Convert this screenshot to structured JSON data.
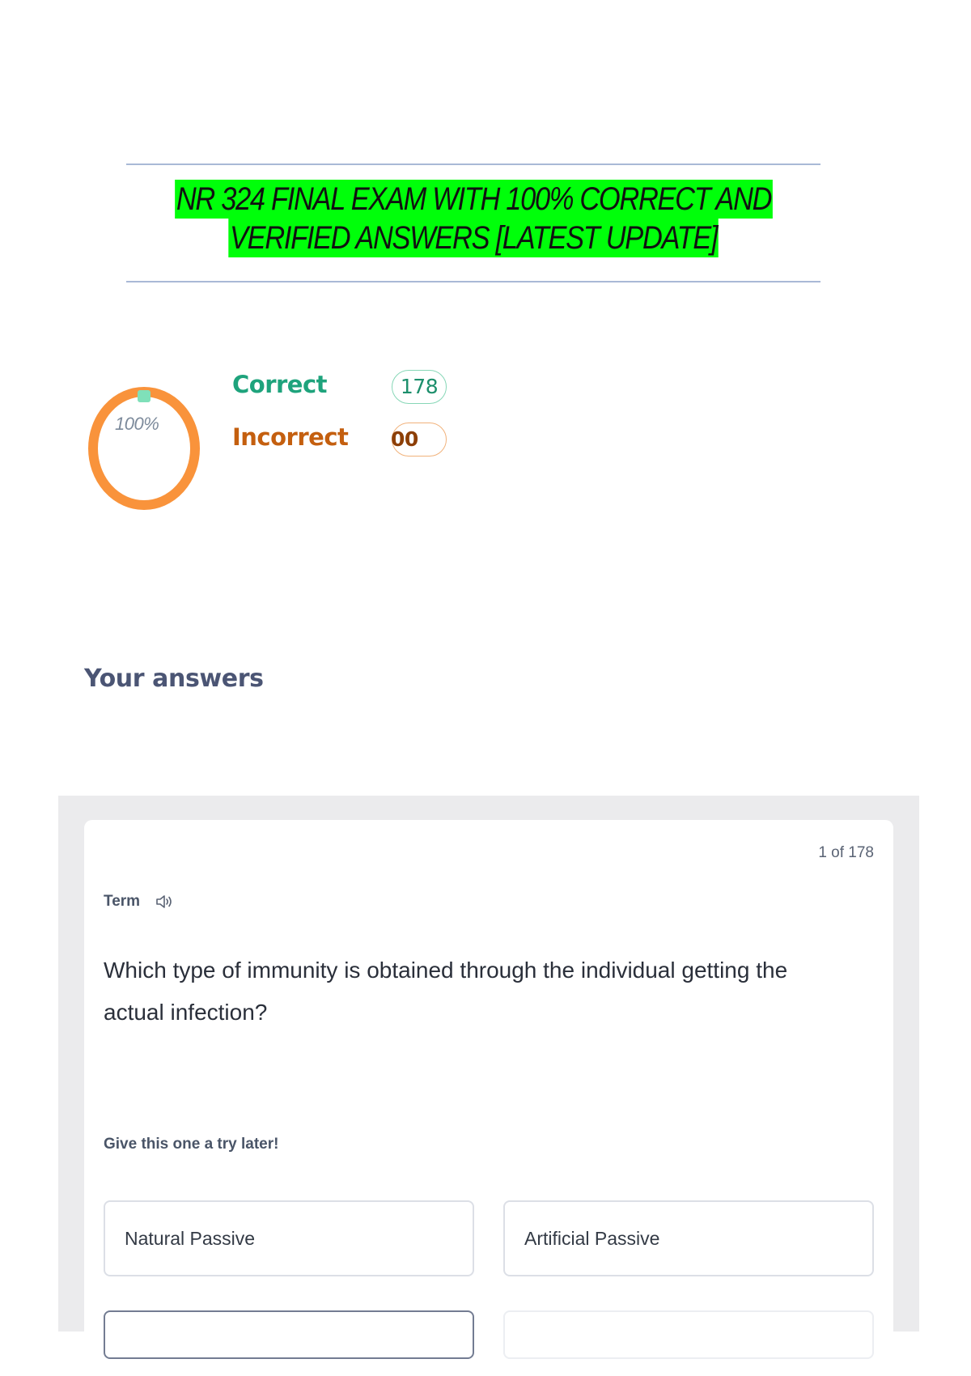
{
  "document": {
    "title_line_1": "NR 324 FINAL EXAM WITH 100% CORRECT AND",
    "title_line_2": "VERIFIED ANSWERS [LATEST UPDATE]"
  },
  "results": {
    "percent_label": "100%",
    "percent_value": 100,
    "correct_label": "Correct",
    "correct_count": "178",
    "incorrect_label": "Incorrect",
    "incorrect_count": "00"
  },
  "answers": {
    "heading": "Your answers"
  },
  "card": {
    "counter": "1 of 178",
    "term_label": "Term",
    "question": "Which type of immunity is obtained through the individual getting the actual infection?",
    "hint": "Give this one a try later!",
    "options": [
      "Natural Passive",
      "Artificial Passive",
      "",
      ""
    ]
  },
  "colors": {
    "title_highlight": "#00ff0a",
    "correct": "#1ea37c",
    "incorrect": "#c45f0f",
    "donut_ring": "#f9933b",
    "donut_marker": "#7fe0b9",
    "rule": "#a9b9d6",
    "card_background": "#ebebed"
  },
  "icons": {
    "speaker": "speaker-icon"
  }
}
